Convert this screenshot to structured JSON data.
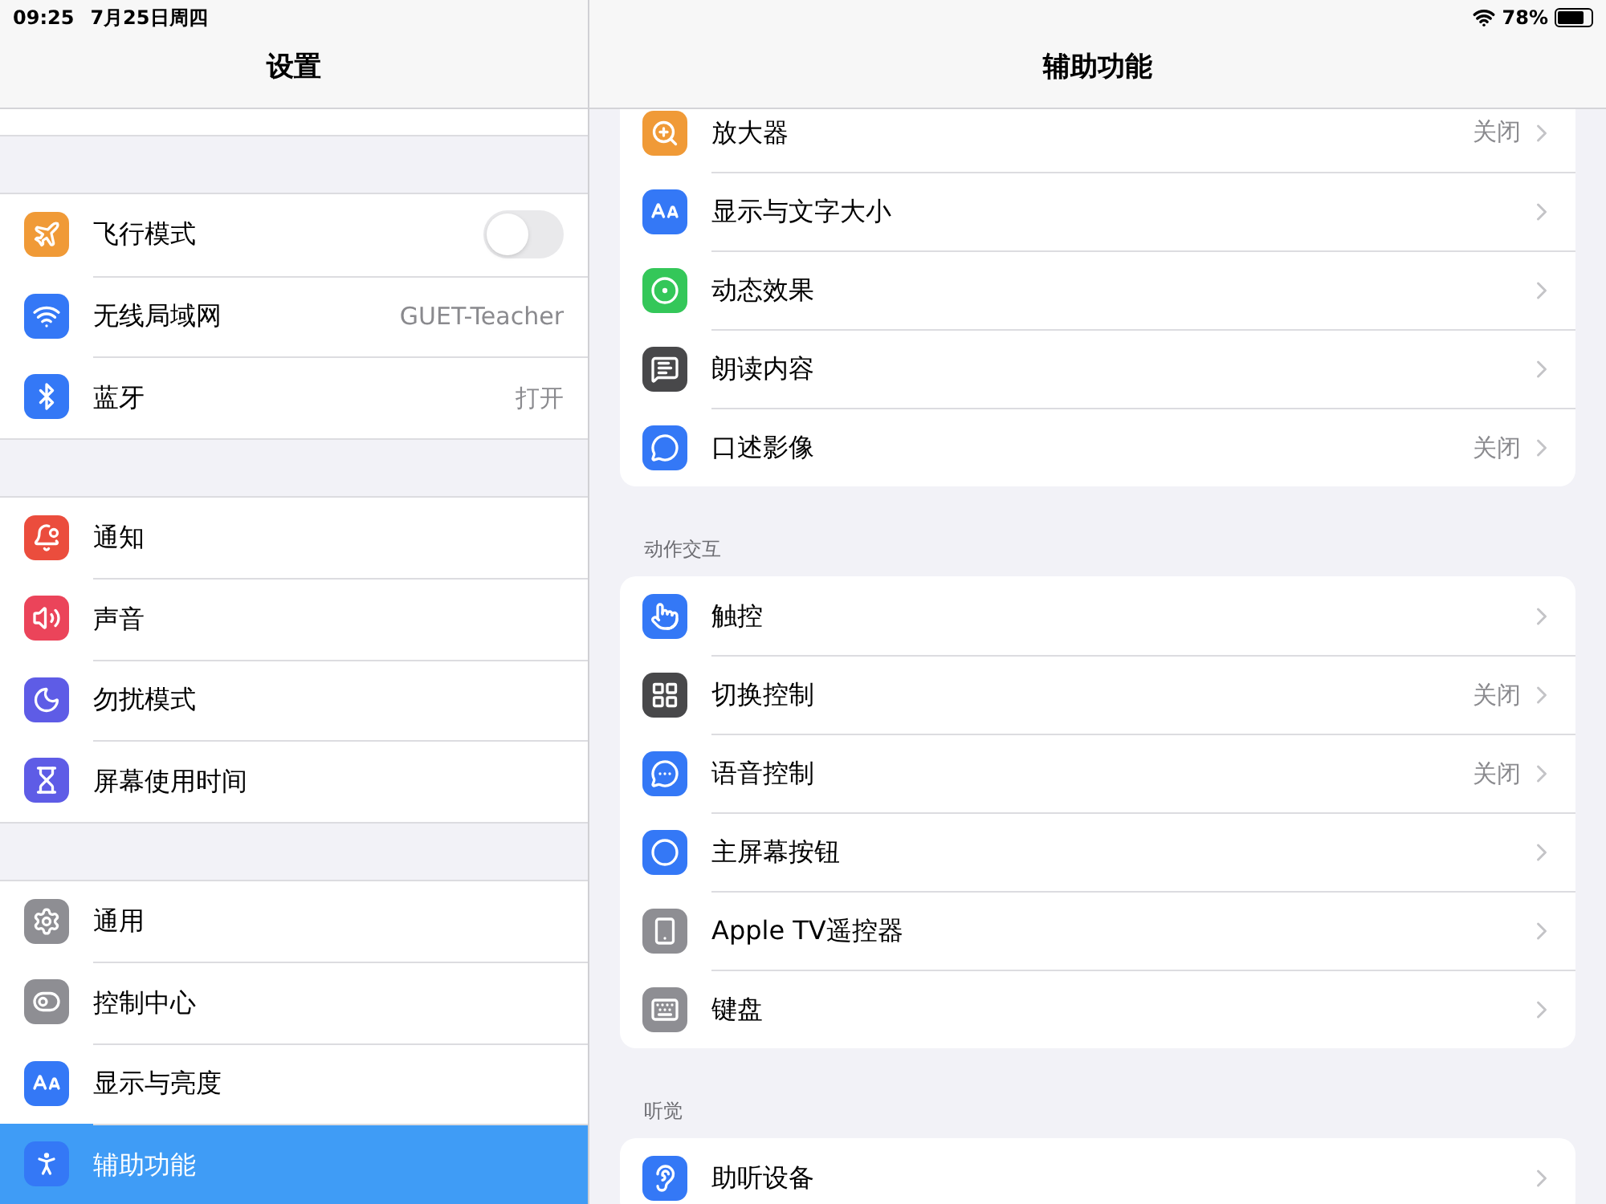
{
  "status_bar": {
    "time": "09:25",
    "date": "7月25日周四",
    "battery": "78%"
  },
  "sidebar": {
    "title": "设置",
    "groups": [
      [
        {
          "label": "飞行模式",
          "kind": "toggle",
          "on": false,
          "selected": false,
          "color": "#f09a37"
        },
        {
          "label": "无线局域网",
          "kind": "link",
          "value": "GUET-Teacher",
          "selected": false,
          "color": "#3478f6"
        },
        {
          "label": "蓝牙",
          "kind": "link",
          "value": "打开",
          "selected": false,
          "color": "#3478f6"
        }
      ],
      [
        {
          "label": "通知",
          "kind": "link",
          "selected": false,
          "color": "#eb4d3d"
        },
        {
          "label": "声音",
          "kind": "link",
          "selected": false,
          "color": "#eb445a"
        },
        {
          "label": "勿扰模式",
          "kind": "link",
          "selected": false,
          "color": "#5e5ce6"
        },
        {
          "label": "屏幕使用时间",
          "kind": "link",
          "selected": false,
          "color": "#5e5ce6"
        }
      ],
      [
        {
          "label": "通用",
          "kind": "link",
          "selected": false,
          "color": "#8e8e93"
        },
        {
          "label": "控制中心",
          "kind": "link",
          "selected": false,
          "color": "#8e8e93"
        },
        {
          "label": "显示与亮度",
          "kind": "link",
          "selected": false,
          "color": "#3478f6"
        },
        {
          "label": "辅助功能",
          "kind": "link",
          "selected": true,
          "color": "#3478f6"
        }
      ]
    ]
  },
  "detail": {
    "title": "辅助功能",
    "sections": [
      {
        "items": [
          {
            "label": "放大器",
            "value": "关闭",
            "color": "#f09a37"
          },
          {
            "label": "显示与文字大小",
            "color": "#3478f6"
          },
          {
            "label": "动态效果",
            "color": "#34c759"
          },
          {
            "label": "朗读内容",
            "color": "#48484a"
          },
          {
            "label": "口述影像",
            "value": "关闭",
            "color": "#3478f6"
          }
        ]
      },
      {
        "header": "动作交互",
        "items": [
          {
            "label": "触控",
            "color": "#3478f6"
          },
          {
            "label": "切换控制",
            "value": "关闭",
            "color": "#48484a"
          },
          {
            "label": "语音控制",
            "value": "关闭",
            "color": "#3478f6"
          },
          {
            "label": "主屏幕按钮",
            "color": "#3478f6"
          },
          {
            "label": "Apple TV遥控器",
            "color": "#8e8e93"
          },
          {
            "label": "键盘",
            "color": "#8e8e93"
          }
        ]
      },
      {
        "header": "听觉",
        "items": [
          {
            "label": "助听设备",
            "color": "#3478f6"
          }
        ]
      }
    ]
  }
}
